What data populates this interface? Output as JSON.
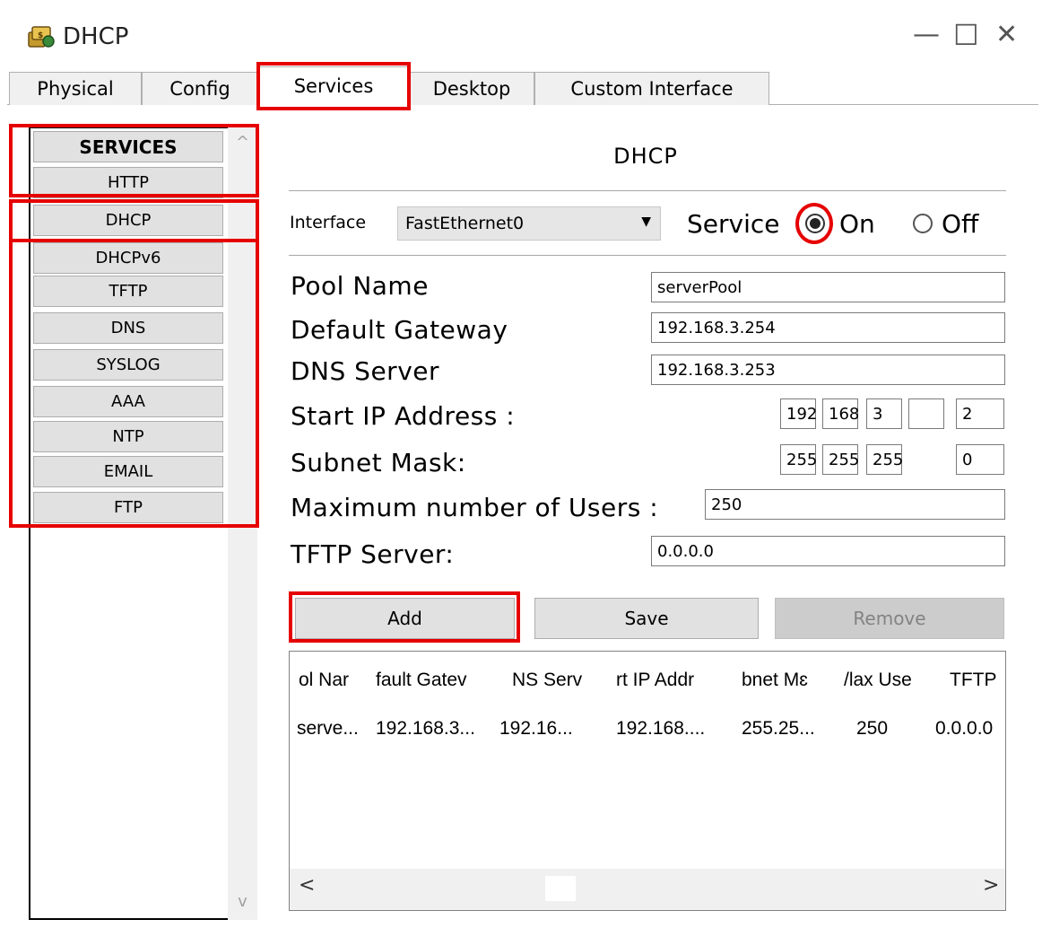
{
  "window": {
    "title": "DHCP",
    "minimize": "—",
    "maximize": "☐",
    "close": "✕"
  },
  "tabs": [
    "Physical",
    "Config",
    "Services",
    "Desktop",
    "Custom Interface"
  ],
  "sidebar": {
    "items": [
      "SERVICES",
      "HTTP",
      "DHCP",
      "DHCPv6",
      "TFTP",
      "DNS",
      "SYSLOG",
      "AAA",
      "NTP",
      "EMAIL",
      "FTP"
    ],
    "scroll_up": "^",
    "scroll_down": "v"
  },
  "panel": {
    "title": "DHCP",
    "interface_label": "Interface",
    "interface_value": "FastEthernet0",
    "service_label": "Service",
    "on_label": "On",
    "off_label": "Off",
    "service_on": true
  },
  "form": {
    "pool_name": {
      "label": "Pool Name",
      "value": "serverPool"
    },
    "default_gateway": {
      "label": "Default Gateway",
      "value": "192.168.3.254"
    },
    "dns_server": {
      "label": "DNS Server",
      "value": "192.168.3.253"
    },
    "start_ip": {
      "label": "Start IP Address :",
      "octets": [
        "192",
        "168",
        "3",
        "2"
      ]
    },
    "subnet_mask": {
      "label": "Subnet Mask:",
      "octets": [
        "255",
        "255",
        "255",
        "0"
      ]
    },
    "max_users": {
      "label": "Maximum number of Users :",
      "value": "250"
    },
    "tftp_server": {
      "label": "TFTP Server:",
      "value": "0.0.0.0"
    }
  },
  "buttons": {
    "add": "Add",
    "save": "Save",
    "remove": "Remove"
  },
  "table": {
    "columns": [
      "ol Nar",
      "fault Gatev",
      "NS Serv",
      "rt IP Addr",
      "bnet Mɛ",
      "/lax Use",
      "TFTP"
    ],
    "rows": [
      [
        "serve...",
        "192.168.3...",
        "192.16...",
        "192.168....",
        "255.25...",
        "250",
        "0.0.0.0"
      ]
    ],
    "scroll_left": "<",
    "scroll_right": ">"
  },
  "colors": {
    "highlight": "#e60000",
    "button_bg": "#e1e1e1",
    "disabled_bg": "#cccccc"
  }
}
